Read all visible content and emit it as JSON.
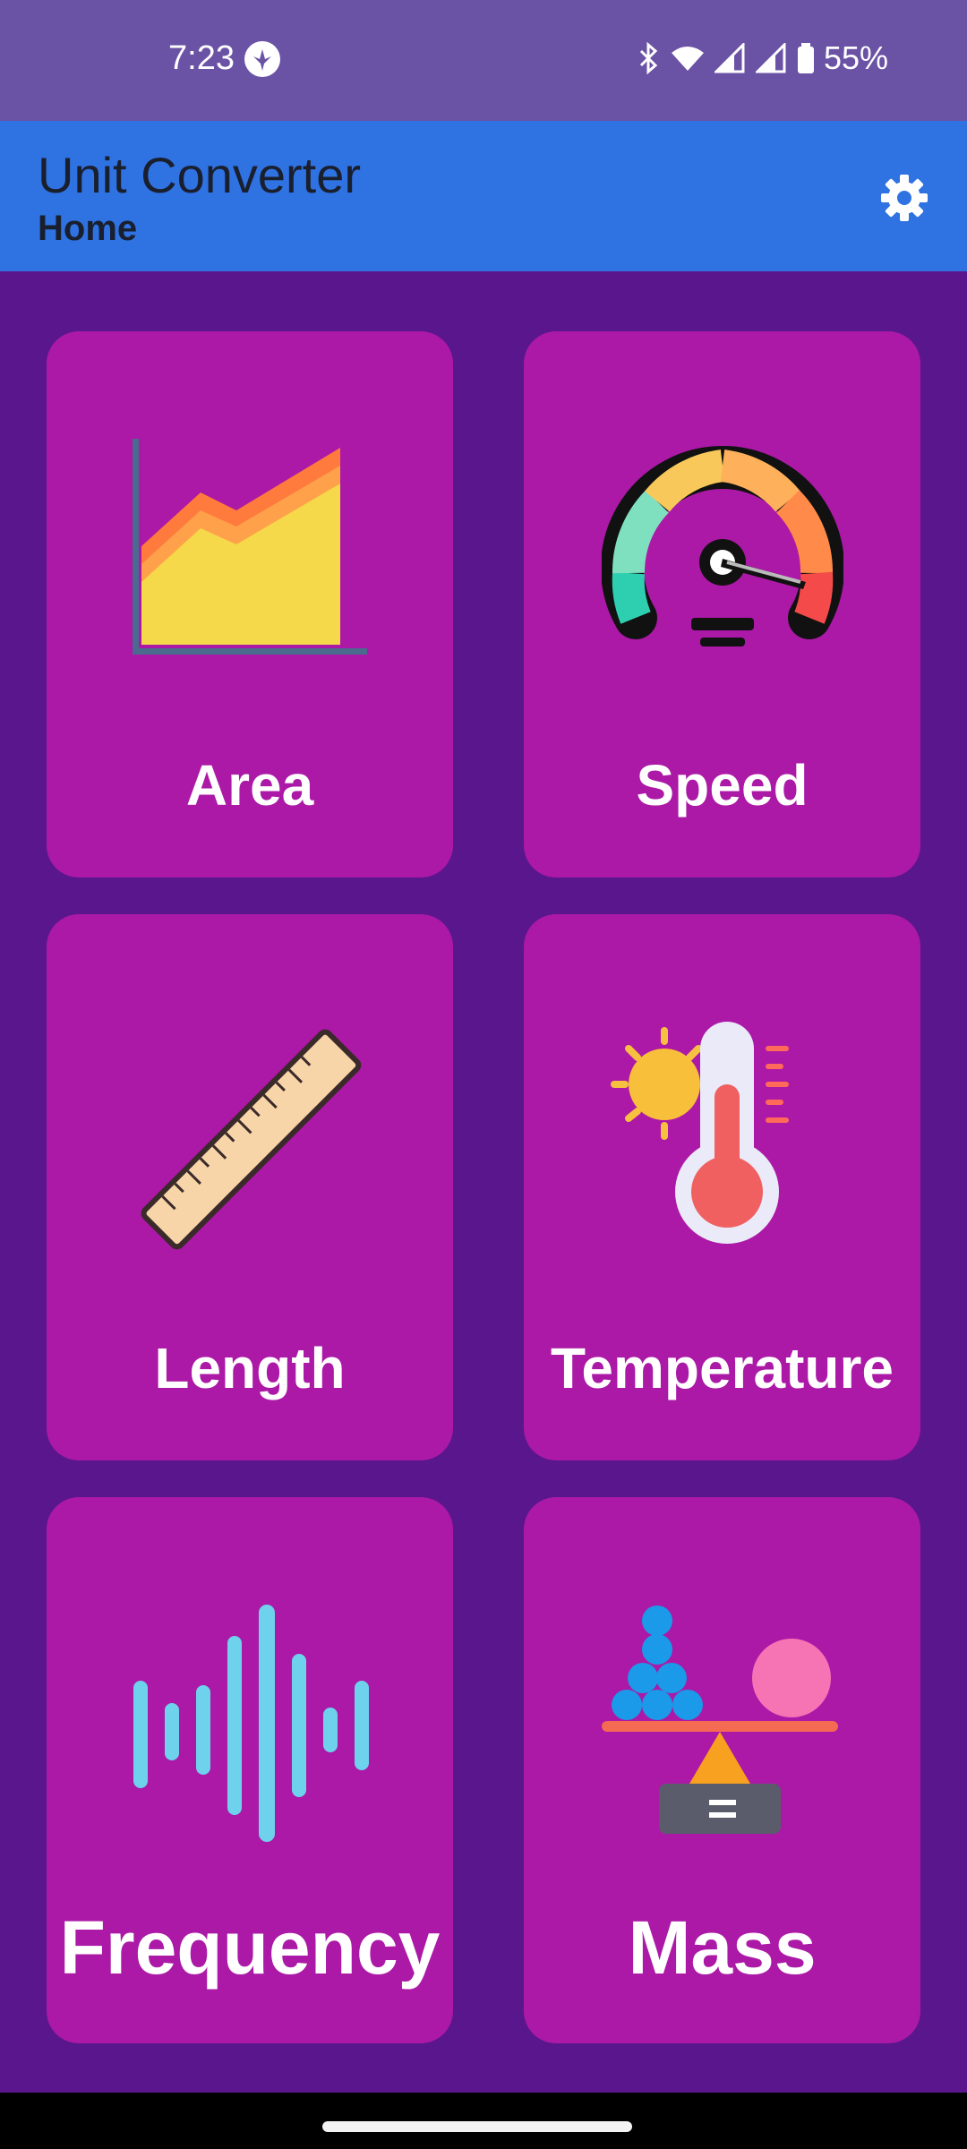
{
  "status_bar": {
    "time": "7:23",
    "battery": "55%"
  },
  "app_bar": {
    "title": "Unit Converter",
    "subtitle": "Home",
    "settings_icon": "gear-icon"
  },
  "cards": [
    {
      "label": "Area",
      "icon": "area-chart-icon"
    },
    {
      "label": "Speed",
      "icon": "speedometer-icon"
    },
    {
      "label": "Length",
      "icon": "ruler-icon"
    },
    {
      "label": "Temperature",
      "icon": "thermometer-sun-icon"
    },
    {
      "label": "Frequency",
      "icon": "sound-wave-icon"
    },
    {
      "label": "Mass",
      "icon": "balance-scale-icon"
    }
  ],
  "colors": {
    "background": "#5a168d",
    "status_bar": "#6a52a5",
    "app_bar": "#2f72e2",
    "card": "#ab19a6"
  }
}
